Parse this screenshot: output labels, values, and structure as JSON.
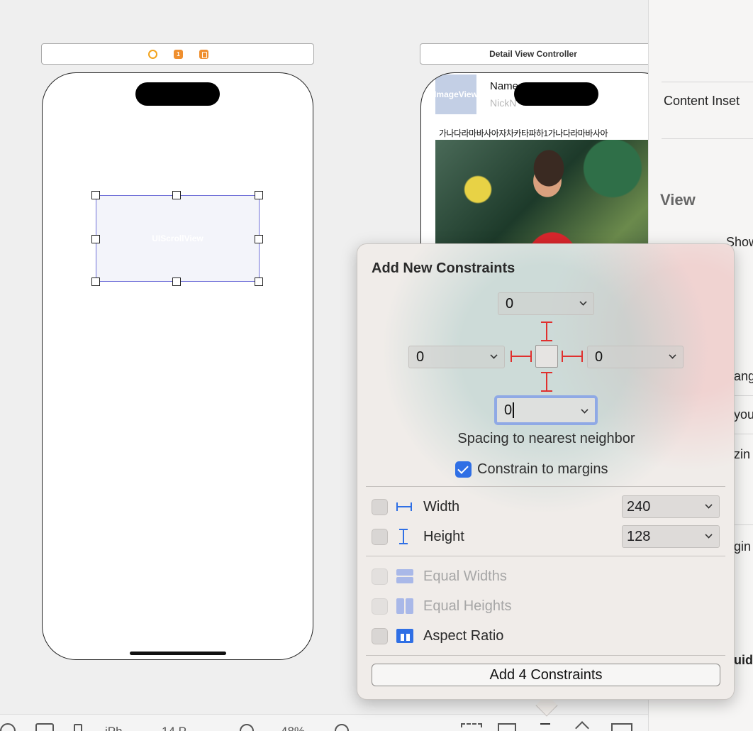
{
  "canvas": {
    "left_scene": {
      "dock_icons": [
        "view-controller-icon",
        "first-responder-icon",
        "exit-icon"
      ],
      "first_responder_badge": "1",
      "selected_view_label": "UIScrollView"
    },
    "right_scene": {
      "title": "Detail View Controller",
      "image_view_label": "ImageView",
      "name_label": "Name",
      "nickname_label": "NickN",
      "body_text": "가나다라마바사아자차카타파하1가나다라마바사아"
    }
  },
  "inspector": {
    "content_insets_label": "Content Inset",
    "view_section": "View",
    "show_label": "Show",
    "partial_labels": [
      "ang",
      "you",
      "zin",
      "gin",
      "uid"
    ]
  },
  "toolbar": {
    "items": [
      "iPh",
      "14 P",
      "48%"
    ]
  },
  "popover": {
    "title": "Add New Constraints",
    "top_value": "0",
    "leading_value": "0",
    "trailing_value": "0",
    "bottom_value": "0",
    "spacing_label": "Spacing to nearest neighbor",
    "constrain_to_margins": {
      "label": "Constrain to margins",
      "checked": true
    },
    "width": {
      "label": "Width",
      "value": "240",
      "checked": false
    },
    "height": {
      "label": "Height",
      "value": "128",
      "checked": false
    },
    "equal_widths": {
      "label": "Equal Widths",
      "enabled": false
    },
    "equal_heights": {
      "label": "Equal Heights",
      "enabled": false
    },
    "aspect_ratio": {
      "label": "Aspect Ratio",
      "checked": false
    },
    "add_button": "Add 4 Constraints",
    "colors": {
      "constraint_red": "#e0302e",
      "accent_blue": "#2f6fe5",
      "focus_ring": "#8fa9e5"
    }
  }
}
